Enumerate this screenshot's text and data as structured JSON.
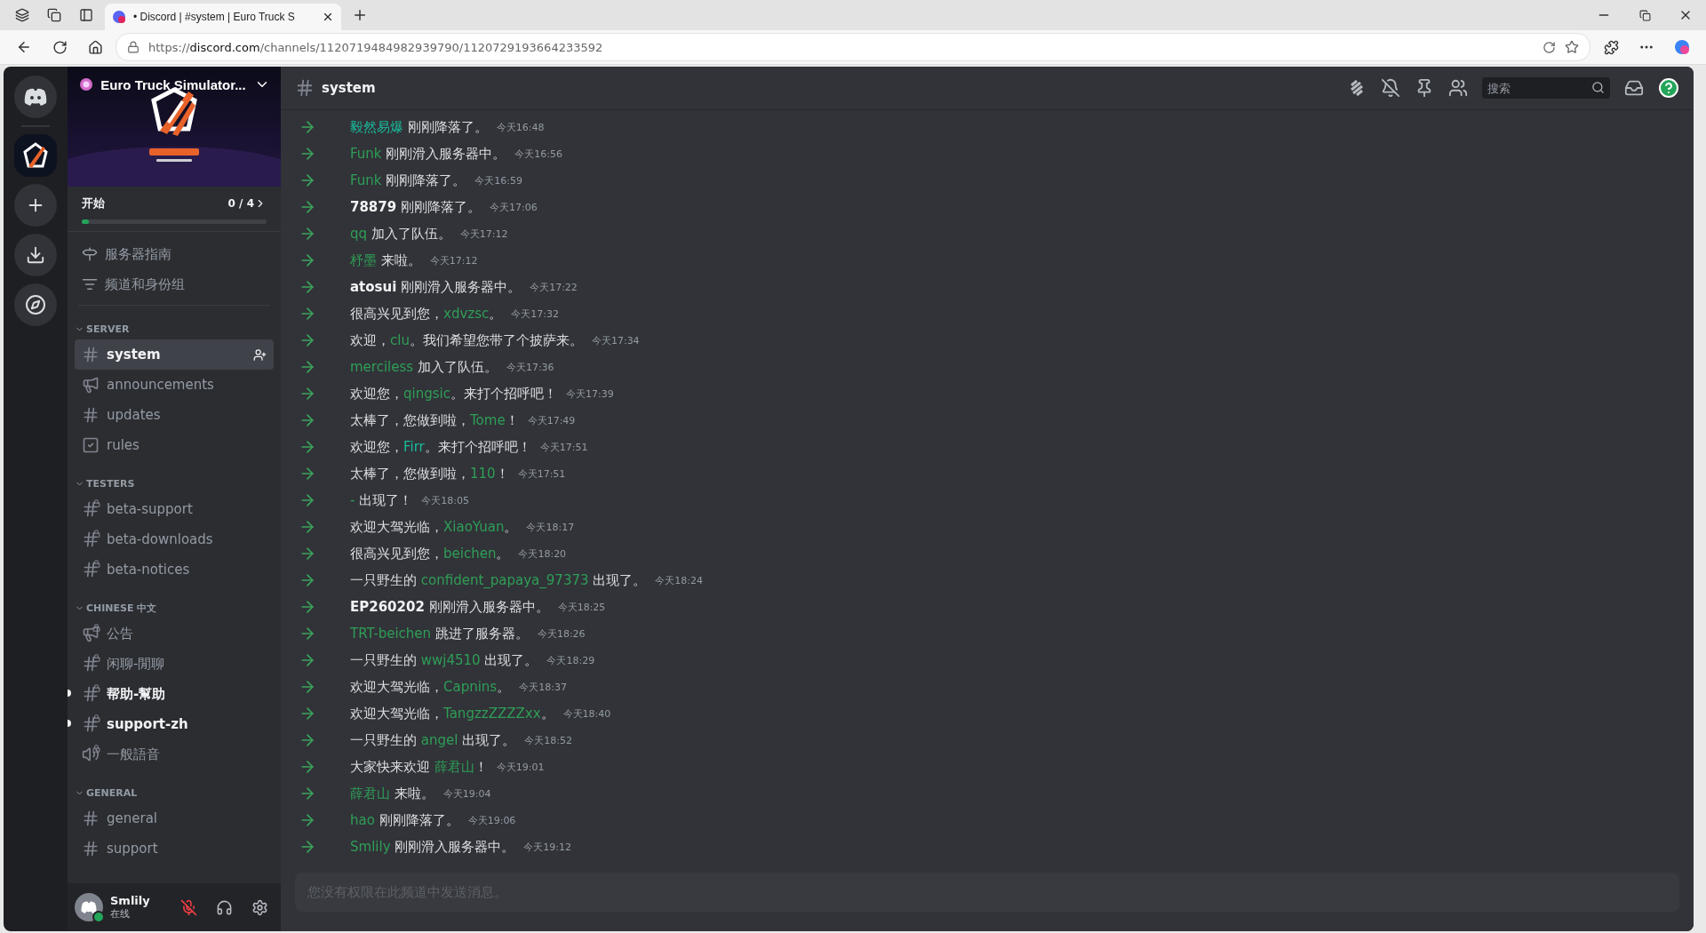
{
  "browser": {
    "tab": {
      "title": "• Discord | #system | Euro Truck S"
    },
    "url": {
      "prefix": "https://",
      "host": "discord.com",
      "path": "/channels/1120719484982939790/1120729193664233592"
    }
  },
  "server": {
    "name": "Euro Truck Simulator...",
    "onboarding": {
      "label": "开始",
      "count": "0 / 4",
      "level": 0.04
    }
  },
  "top_links": [
    {
      "kind": "guide",
      "label": "服务器指南"
    },
    {
      "kind": "browse",
      "label": "频道和身份组"
    }
  ],
  "categories": [
    {
      "name": "SERVER",
      "channels": [
        {
          "kind": "text",
          "name": "system",
          "selected": true,
          "locked": false,
          "unread": false
        },
        {
          "kind": "announcement",
          "name": "announcements",
          "selected": false,
          "locked": false,
          "unread": false
        },
        {
          "kind": "text",
          "name": "updates",
          "selected": false,
          "locked": false,
          "unread": false
        },
        {
          "kind": "rules",
          "name": "rules",
          "selected": false,
          "locked": false,
          "unread": false
        }
      ]
    },
    {
      "name": "TESTERS",
      "channels": [
        {
          "kind": "text",
          "name": "beta-support",
          "selected": false,
          "locked": true,
          "unread": false
        },
        {
          "kind": "text",
          "name": "beta-downloads",
          "selected": false,
          "locked": true,
          "unread": false
        },
        {
          "kind": "text",
          "name": "beta-notices",
          "selected": false,
          "locked": true,
          "unread": false
        }
      ]
    },
    {
      "name": "CHINESE 中文",
      "channels": [
        {
          "kind": "announcement",
          "name": "公告",
          "selected": false,
          "locked": true,
          "unread": false
        },
        {
          "kind": "text",
          "name": "闲聊-閒聊",
          "selected": false,
          "locked": true,
          "unread": false
        },
        {
          "kind": "text",
          "name": "帮助-幫助",
          "selected": false,
          "locked": true,
          "unread": true
        },
        {
          "kind": "text",
          "name": "support-zh",
          "selected": false,
          "locked": true,
          "unread": true
        },
        {
          "kind": "voice",
          "name": "一般語音",
          "selected": false,
          "locked": true,
          "unread": false
        }
      ]
    },
    {
      "name": "GENERAL",
      "channels": [
        {
          "kind": "text",
          "name": "general",
          "selected": false,
          "locked": false,
          "unread": false
        },
        {
          "kind": "text",
          "name": "support",
          "selected": false,
          "locked": false,
          "unread": false
        }
      ]
    }
  ],
  "user": {
    "name": "Smlily",
    "status": "在线"
  },
  "channel_header": {
    "name": "system",
    "search": {
      "placeholder": "搜索"
    }
  },
  "messages": [
    {
      "parts": [
        {
          "kind": "name",
          "text": "毅然易爆",
          "color": "#1abc9c"
        },
        {
          "kind": "text",
          "text": " 刚刚降落了。"
        }
      ],
      "time": "今天16:48"
    },
    {
      "parts": [
        {
          "kind": "name",
          "text": "Funk",
          "color": "#2f9e57"
        },
        {
          "kind": "text",
          "text": " 刚刚滑入服务器中。"
        }
      ],
      "time": "今天16:56"
    },
    {
      "parts": [
        {
          "kind": "name",
          "text": "Funk",
          "color": "#2f9e57"
        },
        {
          "kind": "text",
          "text": " 刚刚降落了。"
        }
      ],
      "time": "今天16:59"
    },
    {
      "parts": [
        {
          "kind": "member",
          "text": "78879"
        },
        {
          "kind": "text",
          "text": " 刚刚降落了。"
        }
      ],
      "time": "今天17:06"
    },
    {
      "parts": [
        {
          "kind": "name",
          "text": "qq",
          "color": "#2f9e57"
        },
        {
          "kind": "text",
          "text": " 加入了队伍。"
        }
      ],
      "time": "今天17:12"
    },
    {
      "parts": [
        {
          "kind": "name",
          "text": "杼墨",
          "color": "#2f9e57"
        },
        {
          "kind": "text",
          "text": " 来啦。"
        }
      ],
      "time": "今天17:12"
    },
    {
      "parts": [
        {
          "kind": "member",
          "text": "atosui"
        },
        {
          "kind": "text",
          "text": " 刚刚滑入服务器中。"
        }
      ],
      "time": "今天17:22"
    },
    {
      "parts": [
        {
          "kind": "text",
          "text": "很高兴见到您，"
        },
        {
          "kind": "name",
          "text": "xdvzsc",
          "color": "#2f9e57"
        },
        {
          "kind": "text",
          "text": "。"
        }
      ],
      "time": "今天17:32"
    },
    {
      "parts": [
        {
          "kind": "text",
          "text": "欢迎，"
        },
        {
          "kind": "name",
          "text": "clu",
          "color": "#2f9e57"
        },
        {
          "kind": "text",
          "text": "。我们希望您带了个披萨来。"
        }
      ],
      "time": "今天17:34"
    },
    {
      "parts": [
        {
          "kind": "name",
          "text": "merciless",
          "color": "#2f9e57"
        },
        {
          "kind": "text",
          "text": " 加入了队伍。"
        }
      ],
      "time": "今天17:36"
    },
    {
      "parts": [
        {
          "kind": "text",
          "text": "欢迎您，"
        },
        {
          "kind": "name",
          "text": "qingsic",
          "color": "#2f9e57"
        },
        {
          "kind": "text",
          "text": "。来打个招呼吧！"
        }
      ],
      "time": "今天17:39"
    },
    {
      "parts": [
        {
          "kind": "text",
          "text": "太棒了，您做到啦，"
        },
        {
          "kind": "name",
          "text": "Tome",
          "color": "#2f9e57"
        },
        {
          "kind": "text",
          "text": "！"
        }
      ],
      "time": "今天17:49"
    },
    {
      "parts": [
        {
          "kind": "text",
          "text": "欢迎您，"
        },
        {
          "kind": "name",
          "text": "Firr",
          "color": "#1abc9c"
        },
        {
          "kind": "text",
          "text": "。来打个招呼吧！"
        }
      ],
      "time": "今天17:51"
    },
    {
      "parts": [
        {
          "kind": "text",
          "text": "太棒了，您做到啦，"
        },
        {
          "kind": "name",
          "text": "110",
          "color": "#2f9e57"
        },
        {
          "kind": "text",
          "text": "！"
        }
      ],
      "time": "今天17:51"
    },
    {
      "parts": [
        {
          "kind": "name",
          "text": "-",
          "color": "#2f9e57"
        },
        {
          "kind": "text",
          "text": " 出现了！"
        }
      ],
      "time": "今天18:05"
    },
    {
      "parts": [
        {
          "kind": "text",
          "text": "欢迎大驾光临，"
        },
        {
          "kind": "name",
          "text": "XiaoYuan",
          "color": "#2f9e57"
        },
        {
          "kind": "text",
          "text": "。"
        }
      ],
      "time": "今天18:17"
    },
    {
      "parts": [
        {
          "kind": "text",
          "text": "很高兴见到您，"
        },
        {
          "kind": "name",
          "text": "beichen",
          "color": "#2f9e57"
        },
        {
          "kind": "text",
          "text": "。"
        }
      ],
      "time": "今天18:20"
    },
    {
      "parts": [
        {
          "kind": "text",
          "text": "一只野生的 "
        },
        {
          "kind": "name",
          "text": "confident_papaya_97373",
          "color": "#2f9e57"
        },
        {
          "kind": "text",
          "text": " 出现了。"
        }
      ],
      "time": "今天18:24"
    },
    {
      "parts": [
        {
          "kind": "member",
          "text": "EP260202"
        },
        {
          "kind": "text",
          "text": " 刚刚滑入服务器中。"
        }
      ],
      "time": "今天18:25"
    },
    {
      "parts": [
        {
          "kind": "name",
          "text": "TRT-beichen",
          "color": "#2f9e57"
        },
        {
          "kind": "text",
          "text": " 跳进了服务器。"
        }
      ],
      "time": "今天18:26"
    },
    {
      "parts": [
        {
          "kind": "text",
          "text": "一只野生的 "
        },
        {
          "kind": "name",
          "text": "wwj4510",
          "color": "#2f9e57"
        },
        {
          "kind": "text",
          "text": " 出现了。"
        }
      ],
      "time": "今天18:29"
    },
    {
      "parts": [
        {
          "kind": "text",
          "text": "欢迎大驾光临，"
        },
        {
          "kind": "name",
          "text": "Capnins",
          "color": "#2f9e57"
        },
        {
          "kind": "text",
          "text": "。"
        }
      ],
      "time": "今天18:37"
    },
    {
      "parts": [
        {
          "kind": "text",
          "text": "欢迎大驾光临，"
        },
        {
          "kind": "name",
          "text": "TangzzZZZZxx",
          "color": "#2f9e57"
        },
        {
          "kind": "text",
          "text": "。"
        }
      ],
      "time": "今天18:40"
    },
    {
      "parts": [
        {
          "kind": "text",
          "text": "一只野生的 "
        },
        {
          "kind": "name",
          "text": "angel",
          "color": "#2f9e57"
        },
        {
          "kind": "text",
          "text": " 出现了。"
        }
      ],
      "time": "今天18:52"
    },
    {
      "parts": [
        {
          "kind": "text",
          "text": "大家快来欢迎 "
        },
        {
          "kind": "name",
          "text": "薛君山",
          "color": "#2f9e57"
        },
        {
          "kind": "text",
          "text": "！"
        }
      ],
      "time": "今天19:01"
    },
    {
      "parts": [
        {
          "kind": "name",
          "text": "薛君山",
          "color": "#2f9e57"
        },
        {
          "kind": "text",
          "text": " 来啦。"
        }
      ],
      "time": "今天19:04"
    },
    {
      "parts": [
        {
          "kind": "name",
          "text": "hao",
          "color": "#2f9e57"
        },
        {
          "kind": "text",
          "text": " 刚刚降落了。"
        }
      ],
      "time": "今天19:06"
    },
    {
      "parts": [
        {
          "kind": "name",
          "text": "Smlily",
          "color": "#2f9e57"
        },
        {
          "kind": "text",
          "text": " 刚刚滑入服务器中。"
        }
      ],
      "time": "今天19:12"
    }
  ],
  "composer": {
    "placeholder": "您没有权限在此频道中发送消息。"
  }
}
